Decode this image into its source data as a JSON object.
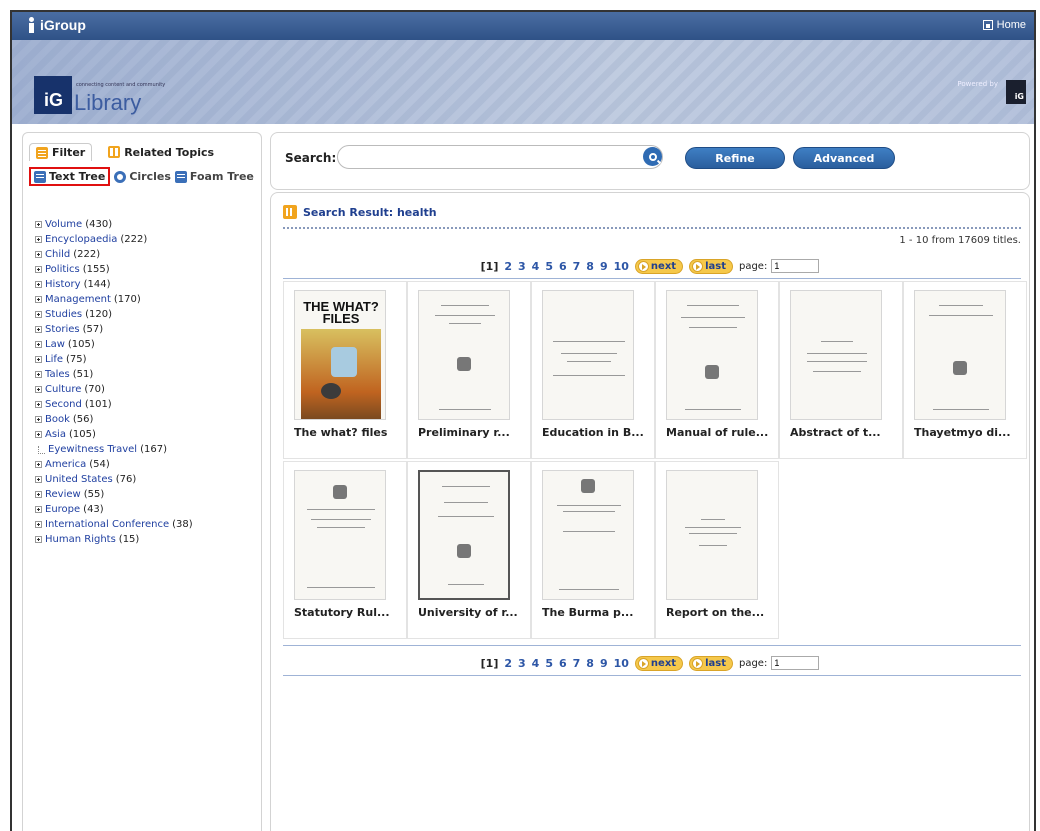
{
  "app": {
    "brand": "iGroup",
    "home_label": "Home",
    "library_label": "Library",
    "logo_mark": "iG",
    "tagline": "connecting content and community",
    "powered_by": "Powered by",
    "powered_mark": "iG"
  },
  "sidebar": {
    "tabs": [
      {
        "label": "Filter"
      },
      {
        "label": "Related Topics"
      }
    ],
    "views": [
      {
        "label": "Text Tree"
      },
      {
        "label": "Circles"
      },
      {
        "label": "Foam Tree"
      }
    ],
    "tree": [
      {
        "label": "Volume",
        "count": "(430)"
      },
      {
        "label": "Encyclopaedia",
        "count": "(222)"
      },
      {
        "label": "Child",
        "count": "(222)"
      },
      {
        "label": "Politics",
        "count": "(155)"
      },
      {
        "label": "History",
        "count": "(144)"
      },
      {
        "label": "Management",
        "count": "(170)"
      },
      {
        "label": "Studies",
        "count": "(120)"
      },
      {
        "label": "Stories",
        "count": "(57)"
      },
      {
        "label": "Law",
        "count": "(105)"
      },
      {
        "label": "Life",
        "count": "(75)"
      },
      {
        "label": "Tales",
        "count": "(51)"
      },
      {
        "label": "Culture",
        "count": "(70)"
      },
      {
        "label": "Second",
        "count": "(101)"
      },
      {
        "label": "Book",
        "count": "(56)"
      },
      {
        "label": "Asia",
        "count": "(105)"
      },
      {
        "label": "Eyewitness Travel",
        "count": "(167)"
      },
      {
        "label": "America",
        "count": "(54)"
      },
      {
        "label": "United States",
        "count": "(76)"
      },
      {
        "label": "Review",
        "count": "(55)"
      },
      {
        "label": "Europe",
        "count": "(43)"
      },
      {
        "label": "International Conference",
        "count": "(38)"
      },
      {
        "label": "Human Rights",
        "count": "(15)"
      }
    ]
  },
  "search": {
    "label": "Search:",
    "value": "",
    "placeholder": "",
    "refine_label": "Refine",
    "advanced_label": "Advanced"
  },
  "results": {
    "heading": "Search Result: health",
    "count_text": "1 - 10 from 17609 titles.",
    "pager": {
      "current": "[1]",
      "pages": [
        "2",
        "3",
        "4",
        "5",
        "6",
        "7",
        "8",
        "9",
        "10"
      ],
      "next_label": "next",
      "last_label": "last",
      "page_label": "page:",
      "page_value": "1"
    },
    "items": [
      {
        "title": "The what? files",
        "cover_title": "THE WHAT? FILES"
      },
      {
        "title": "Preliminary r..."
      },
      {
        "title": "Education in B..."
      },
      {
        "title": "Manual of rule..."
      },
      {
        "title": "Abstract of t..."
      },
      {
        "title": "Thayetmyo di..."
      },
      {
        "title": "Statutory Rul..."
      },
      {
        "title": "University of r..."
      },
      {
        "title": "The Burma p..."
      },
      {
        "title": "Report on the..."
      }
    ]
  }
}
